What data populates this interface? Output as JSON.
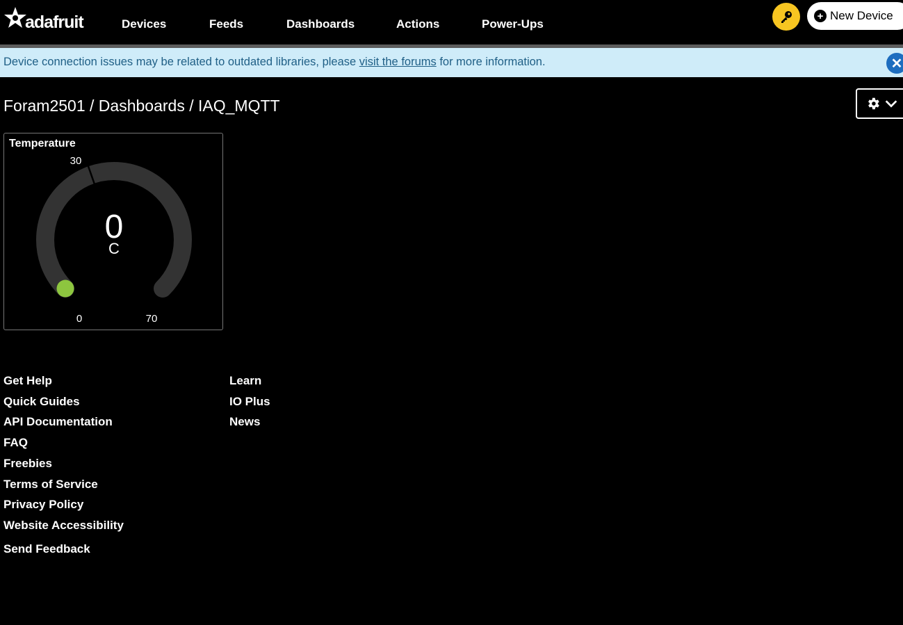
{
  "brand": {
    "logo_text": "adafruit"
  },
  "nav": {
    "items": [
      {
        "label": "Devices"
      },
      {
        "label": "Feeds"
      },
      {
        "label": "Dashboards"
      },
      {
        "label": "Actions"
      },
      {
        "label": "Power-Ups"
      }
    ],
    "key_icon": "key-icon",
    "new_device_label": "New Device"
  },
  "banner": {
    "text_before": "Device connection issues may be related to outdated libraries, please ",
    "link_text": "visit the forums",
    "text_after": " for more information.",
    "background": "#cfecf9",
    "text_color": "#1f5f86"
  },
  "breadcrumb": {
    "user": "Foram2501",
    "separator": " / ",
    "section": "Dashboards",
    "dashboard": "IAQ_MQTT"
  },
  "gauge": {
    "title": "Temperature",
    "value": "0",
    "unit": "C",
    "min": "0",
    "max": "70",
    "tick": "30",
    "value_numeric": 0,
    "min_numeric": 0,
    "max_numeric": 70,
    "tick_numeric": 30,
    "indicator_color": "#8dc63f",
    "track_color": "#333333"
  },
  "footer": {
    "column1": [
      "Get Help",
      "Quick Guides",
      "API Documentation",
      "FAQ",
      "Freebies",
      "Terms of Service",
      "Privacy Policy",
      "Website Accessibility",
      "Send Feedback"
    ],
    "column2": [
      "Learn",
      "IO Plus",
      "News"
    ]
  }
}
